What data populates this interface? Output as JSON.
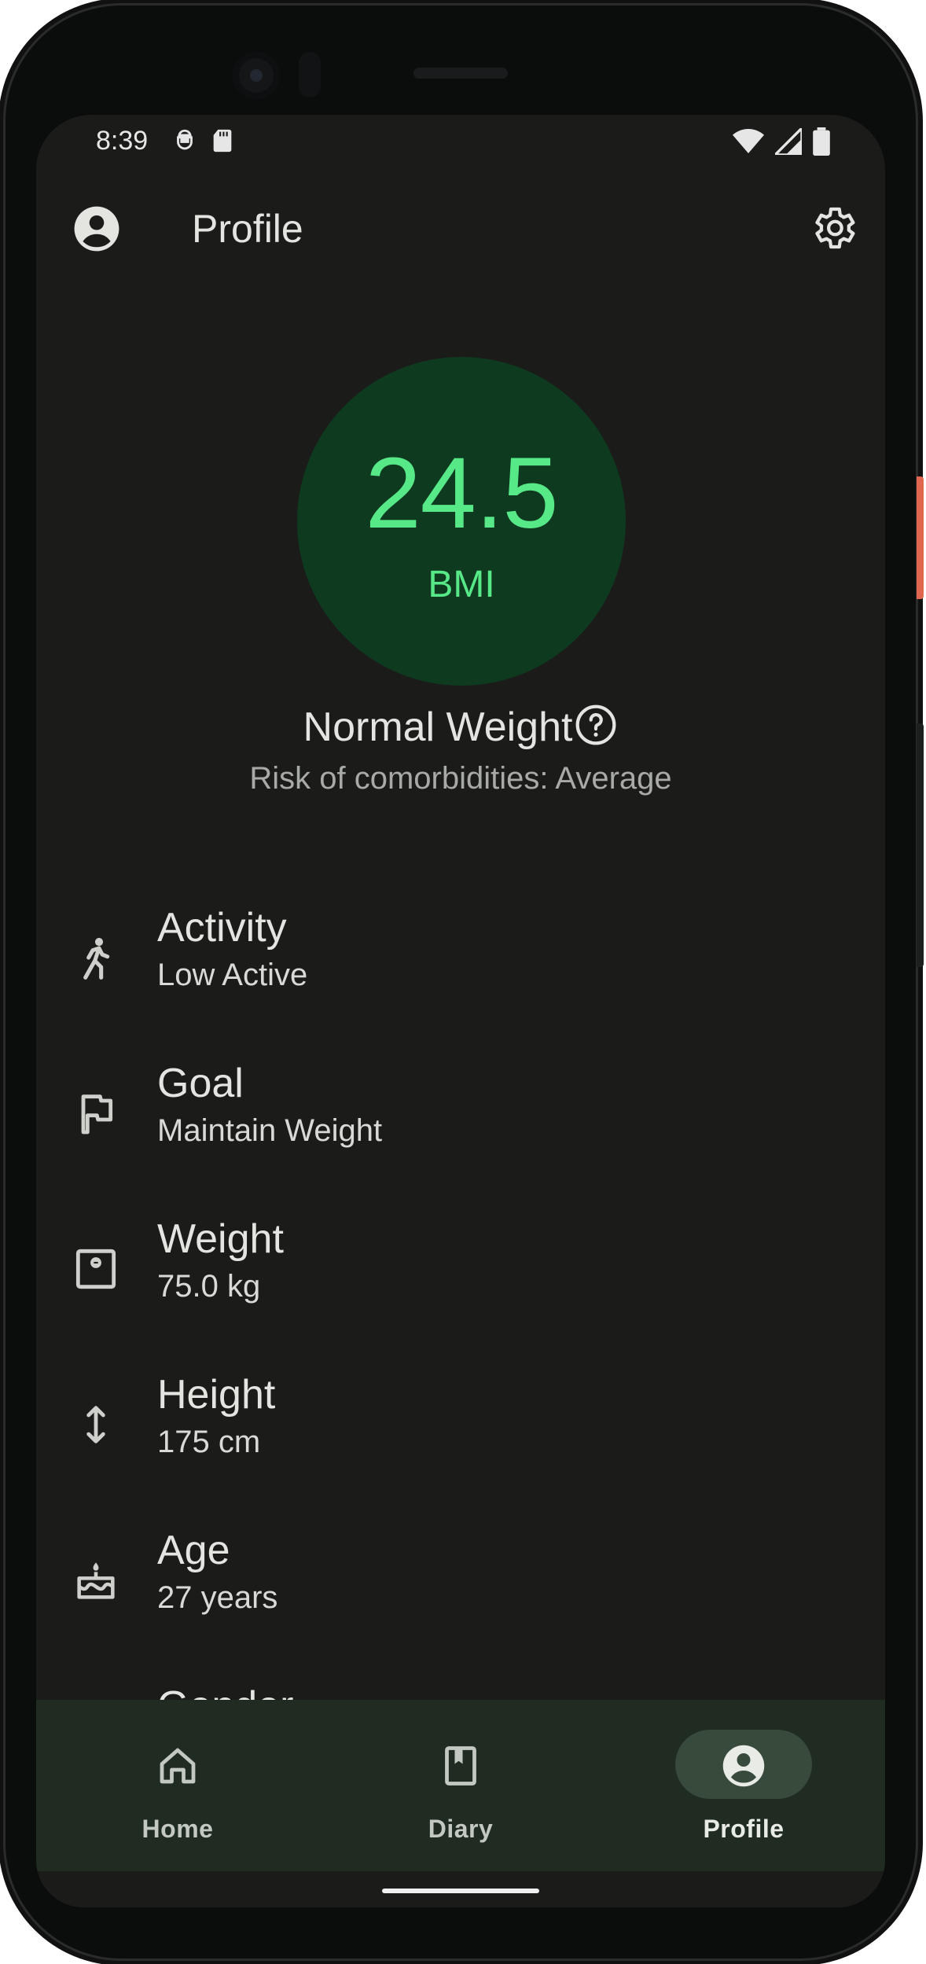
{
  "status_bar": {
    "time": "8:39"
  },
  "app_bar": {
    "title": "Profile"
  },
  "bmi": {
    "value": "24.5",
    "label": "BMI",
    "category": "Normal Weight",
    "risk": "Risk of comorbidities: Average"
  },
  "profile_items": [
    {
      "label": "Activity",
      "value": "Low Active",
      "icon": "walking-icon"
    },
    {
      "label": "Goal",
      "value": "Maintain Weight",
      "icon": "flag-icon"
    },
    {
      "label": "Weight",
      "value": "75.0 kg",
      "icon": "scale-icon"
    },
    {
      "label": "Height",
      "value": "175 cm",
      "icon": "height-arrow-icon"
    },
    {
      "label": "Age",
      "value": "27 years",
      "icon": "cake-icon"
    },
    {
      "label": "Gender",
      "value": "",
      "icon": "gender-icon"
    }
  ],
  "nav": [
    {
      "label": "Home",
      "icon": "home-icon",
      "active": false
    },
    {
      "label": "Diary",
      "icon": "diary-book-icon",
      "active": false
    },
    {
      "label": "Profile",
      "icon": "account-circle-icon",
      "active": true
    }
  ],
  "colors": {
    "background": "#1b1c1a",
    "bmi_circle": "#0e3a20",
    "bmi_accent": "#57e888",
    "nav_background": "#202b22",
    "nav_active_pill": "#374a3b"
  }
}
